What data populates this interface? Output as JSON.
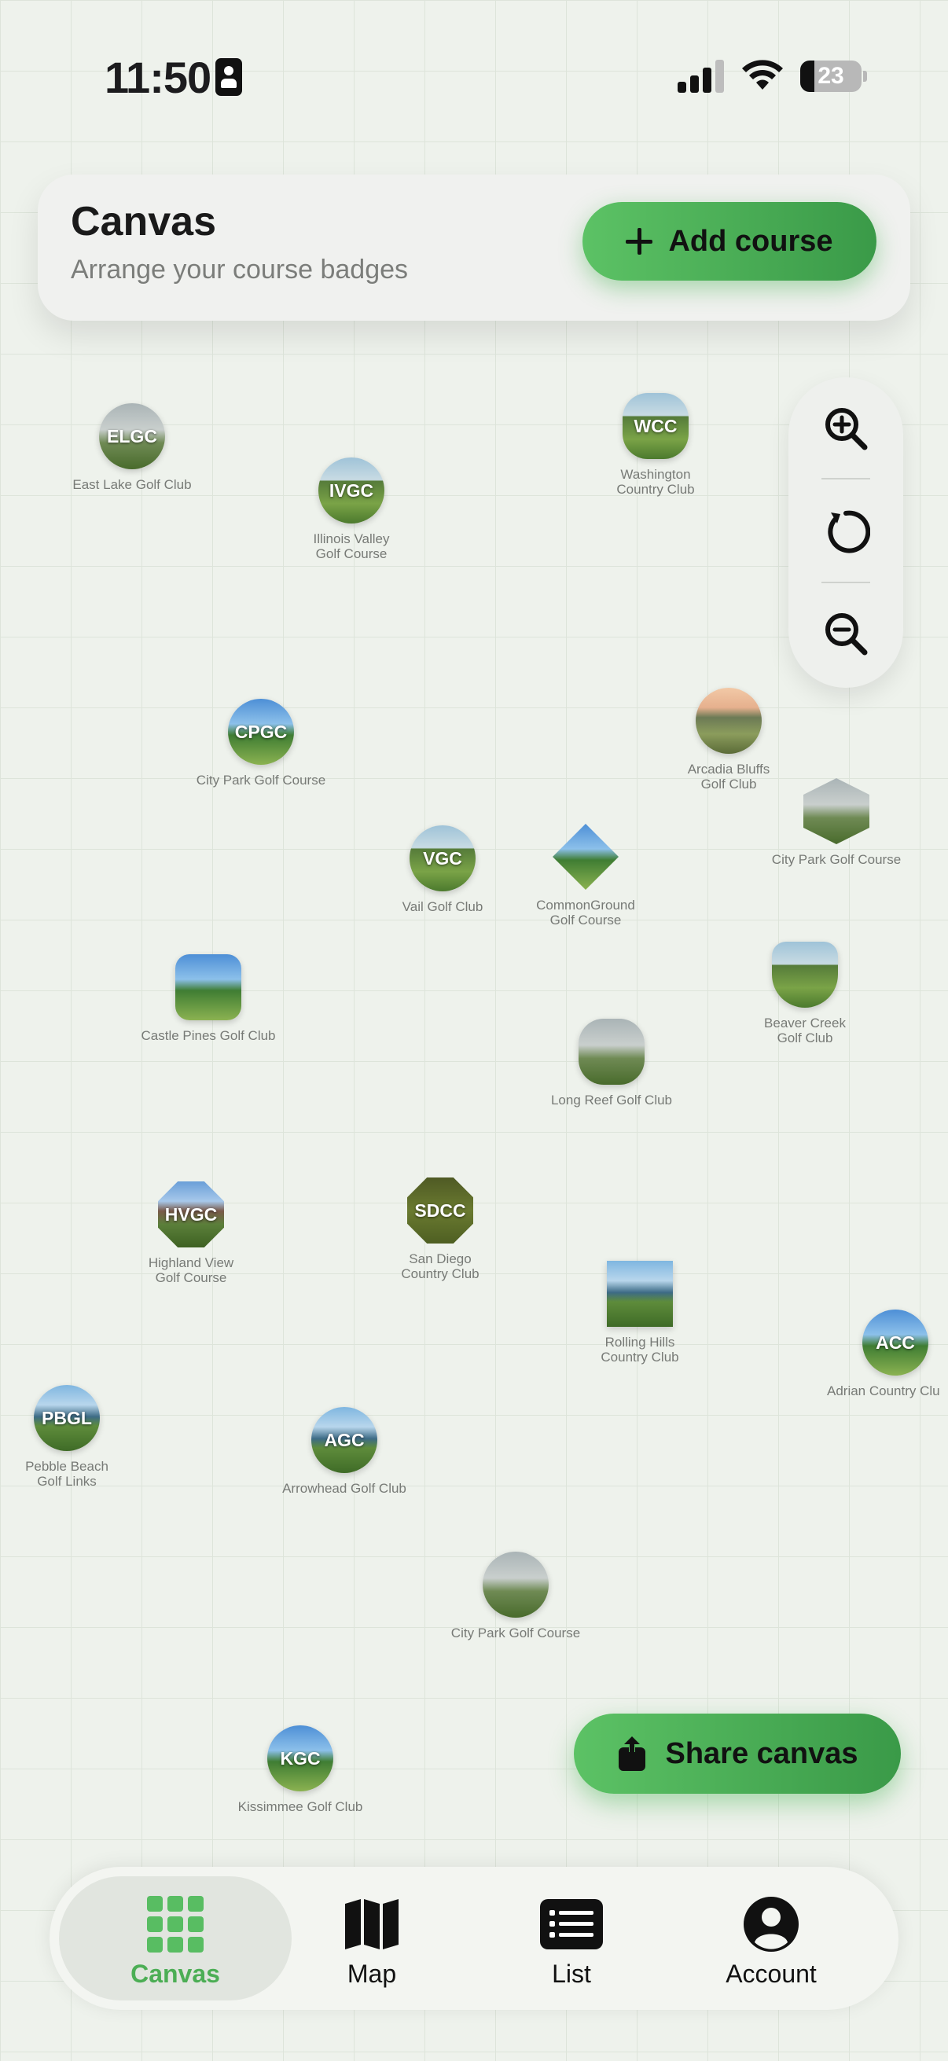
{
  "status_bar": {
    "time": "11:50",
    "battery": "23"
  },
  "header": {
    "title": "Canvas",
    "subtitle": "Arrange your course badges",
    "add_button_label": "Add course"
  },
  "zoom_controls": {
    "icons": [
      "zoom-in-icon",
      "reset-icon",
      "zoom-out-icon"
    ]
  },
  "badges": [
    {
      "abbr": "ELGC",
      "label": "East Lake Golf Club"
    },
    {
      "abbr": "IVGC",
      "label": "Illinois Valley\nGolf Course"
    },
    {
      "abbr": "WCC",
      "label": "Washington\nCountry Club"
    },
    {
      "abbr": "CPGC",
      "label": "City Park Golf Course"
    },
    {
      "abbr": "",
      "label": "Arcadia Bluffs\nGolf Club"
    },
    {
      "abbr": "",
      "label": "City Park Golf Course"
    },
    {
      "abbr": "VGC",
      "label": "Vail Golf Club"
    },
    {
      "abbr": "",
      "label": "CommonGround\nGolf Course"
    },
    {
      "abbr": "",
      "label": "Castle Pines Golf Club"
    },
    {
      "abbr": "",
      "label": "Beaver Creek\nGolf Club"
    },
    {
      "abbr": "",
      "label": "Long Reef Golf Club"
    },
    {
      "abbr": "HVGC",
      "label": "Highland View\nGolf Course"
    },
    {
      "abbr": "SDCC",
      "label": "San Diego\nCountry Club"
    },
    {
      "abbr": "",
      "label": "Rolling Hills\nCountry Club"
    },
    {
      "abbr": "ACC",
      "label": "Adrian Country Clu"
    },
    {
      "abbr": "PBGL",
      "label": "Pebble Beach\nGolf Links"
    },
    {
      "abbr": "AGC",
      "label": "Arrowhead Golf Club"
    },
    {
      "abbr": "",
      "label": "City Park Golf Course"
    },
    {
      "abbr": "KGC",
      "label": "Kissimmee Golf Club"
    }
  ],
  "share_button_label": "Share canvas",
  "tabs": [
    {
      "label": "Canvas",
      "icon": "grid-icon",
      "active": true
    },
    {
      "label": "Map",
      "icon": "map-icon",
      "active": false
    },
    {
      "label": "List",
      "icon": "list-icon",
      "active": false
    },
    {
      "label": "Account",
      "icon": "account-icon",
      "active": false
    }
  ],
  "colors": {
    "accent": "#4cae55",
    "background": "#eef2ec"
  }
}
